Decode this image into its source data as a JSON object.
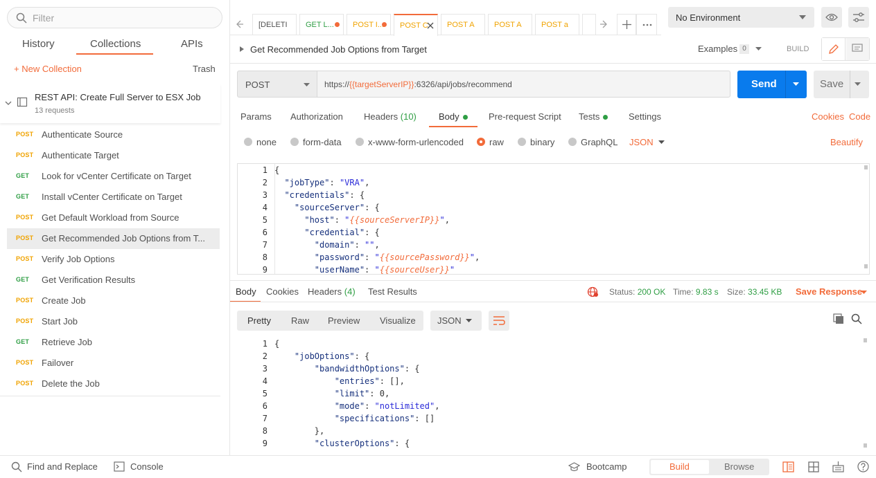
{
  "sidebar": {
    "filter_placeholder": "Filter",
    "tabs": [
      "History",
      "Collections",
      "APIs"
    ],
    "new_collection": "+ New Collection",
    "trash": "Trash",
    "collection": {
      "title": "REST API: Create Full Server to ESX Job",
      "count": "13 requests"
    },
    "requests": [
      {
        "method": "POST",
        "name": "Authenticate Source"
      },
      {
        "method": "POST",
        "name": "Authenticate Target"
      },
      {
        "method": "GET",
        "name": "Look for vCenter Certificate on Target"
      },
      {
        "method": "GET",
        "name": "Install vCenter Certificate on Target"
      },
      {
        "method": "POST",
        "name": "Get Default Workload from Source"
      },
      {
        "method": "POST",
        "name": "Get Recommended Job Options from T..."
      },
      {
        "method": "POST",
        "name": "Verify Job Options"
      },
      {
        "method": "GET",
        "name": "Get Verification Results"
      },
      {
        "method": "POST",
        "name": "Create Job"
      },
      {
        "method": "POST",
        "name": "Start Job"
      },
      {
        "method": "GET",
        "name": "Retrieve Job"
      },
      {
        "method": "POST",
        "name": "Failover"
      },
      {
        "method": "POST",
        "name": "Delete the Job"
      }
    ]
  },
  "tabs": [
    {
      "label": "[DELETI"
    },
    {
      "label": "GET L..."
    },
    {
      "label": "POST I..."
    },
    {
      "label": "POST C"
    },
    {
      "label": "POST A"
    },
    {
      "label": "POST A"
    },
    {
      "label": "POST a"
    }
  ],
  "environment": "No Environment",
  "request": {
    "title": "Get Recommended Job Options from Target",
    "examples": "Examples",
    "examples_count": "0",
    "build": "BUILD",
    "method": "POST",
    "url_prefix": "https://",
    "url_var": "{{targetServerIP}}",
    "url_suffix": ":6326/api/jobs/recommend",
    "send": "Send",
    "save": "Save",
    "subtabs": {
      "params": "Params",
      "authorization": "Authorization",
      "headers": "Headers",
      "headers_count": "(10)",
      "body": "Body",
      "prerequest": "Pre-request Script",
      "tests": "Tests",
      "settings": "Settings",
      "cookies": "Cookies",
      "code": "Code"
    },
    "body_types": [
      "none",
      "form-data",
      "x-www-form-urlencoded",
      "raw",
      "binary",
      "GraphQL"
    ],
    "body_format": "JSON",
    "beautify": "Beautify"
  },
  "response": {
    "tabs": {
      "body": "Body",
      "cookies": "Cookies",
      "headers": "Headers",
      "headers_count": "(4)",
      "tests": "Test Results"
    },
    "status_label": "Status:",
    "status": "200 OK",
    "time_label": "Time:",
    "time": "9.83 s",
    "size_label": "Size:",
    "size": "33.45 KB",
    "save_response": "Save Response",
    "views": [
      "Pretty",
      "Raw",
      "Preview",
      "Visualize"
    ],
    "format": "JSON"
  },
  "footer": {
    "find": "Find and Replace",
    "console": "Console",
    "bootcamp": "Bootcamp",
    "build": "Build",
    "browse": "Browse"
  },
  "colors": {
    "accent": "#f26b3a",
    "send": "#097bed",
    "post": "#f0a300",
    "get": "#2f9e44"
  }
}
